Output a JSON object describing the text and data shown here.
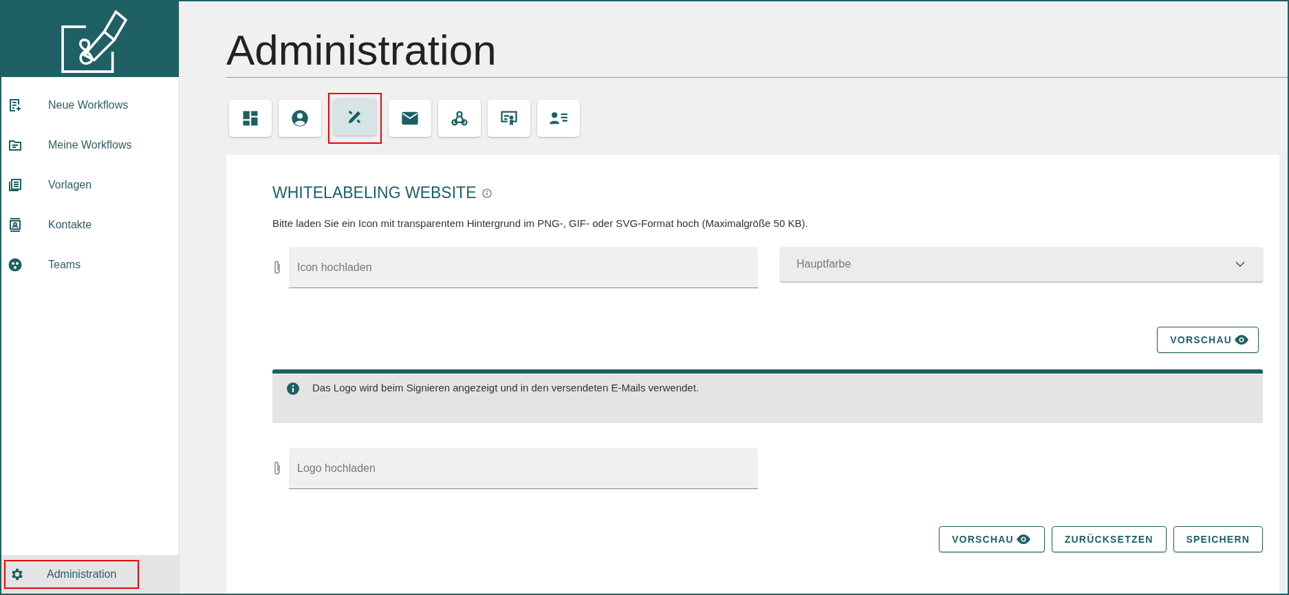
{
  "sidebar": {
    "items": [
      {
        "label": "Neue Workflows",
        "selected": false,
        "highlighted": false
      },
      {
        "label": "Meine Workflows",
        "selected": false,
        "highlighted": false
      },
      {
        "label": "Vorlagen",
        "selected": false,
        "highlighted": false
      },
      {
        "label": "Kontakte",
        "selected": false,
        "highlighted": false
      },
      {
        "label": "Teams",
        "selected": false,
        "highlighted": false
      }
    ],
    "footer_item": {
      "label": "Administration",
      "selected": true,
      "highlighted": true
    }
  },
  "page_title": "Administration",
  "tabs": [
    {
      "selected": false,
      "highlighted": false
    },
    {
      "selected": false,
      "highlighted": false
    },
    {
      "selected": true,
      "highlighted": true
    },
    {
      "selected": false,
      "highlighted": false
    },
    {
      "selected": false,
      "highlighted": false
    },
    {
      "selected": false,
      "highlighted": false
    },
    {
      "selected": false,
      "highlighted": false
    }
  ],
  "section": {
    "title": "WHITELABELING WEBSITE",
    "description": "Bitte laden Sie ein Icon mit transparentem Hintergrund im PNG-, GIF- oder SVG-Format hoch (Maximalgröße 50 KB).",
    "icon_upload": {
      "placeholder": "Icon hochladen"
    },
    "color_select": {
      "placeholder": "Hauptfarbe"
    },
    "preview_button": "VORSCHAU",
    "info": "Das Logo wird beim Signieren angezeigt und in den versendeten E-Mails verwendet.",
    "logo_upload": {
      "placeholder": "Logo hochladen"
    },
    "buttons": [
      {
        "label": "VORSCHAU",
        "kind": "preview"
      },
      {
        "label": "ZURÜCKSETZEN",
        "kind": "plain"
      },
      {
        "label": "SPEICHERN",
        "kind": "plain"
      }
    ]
  }
}
